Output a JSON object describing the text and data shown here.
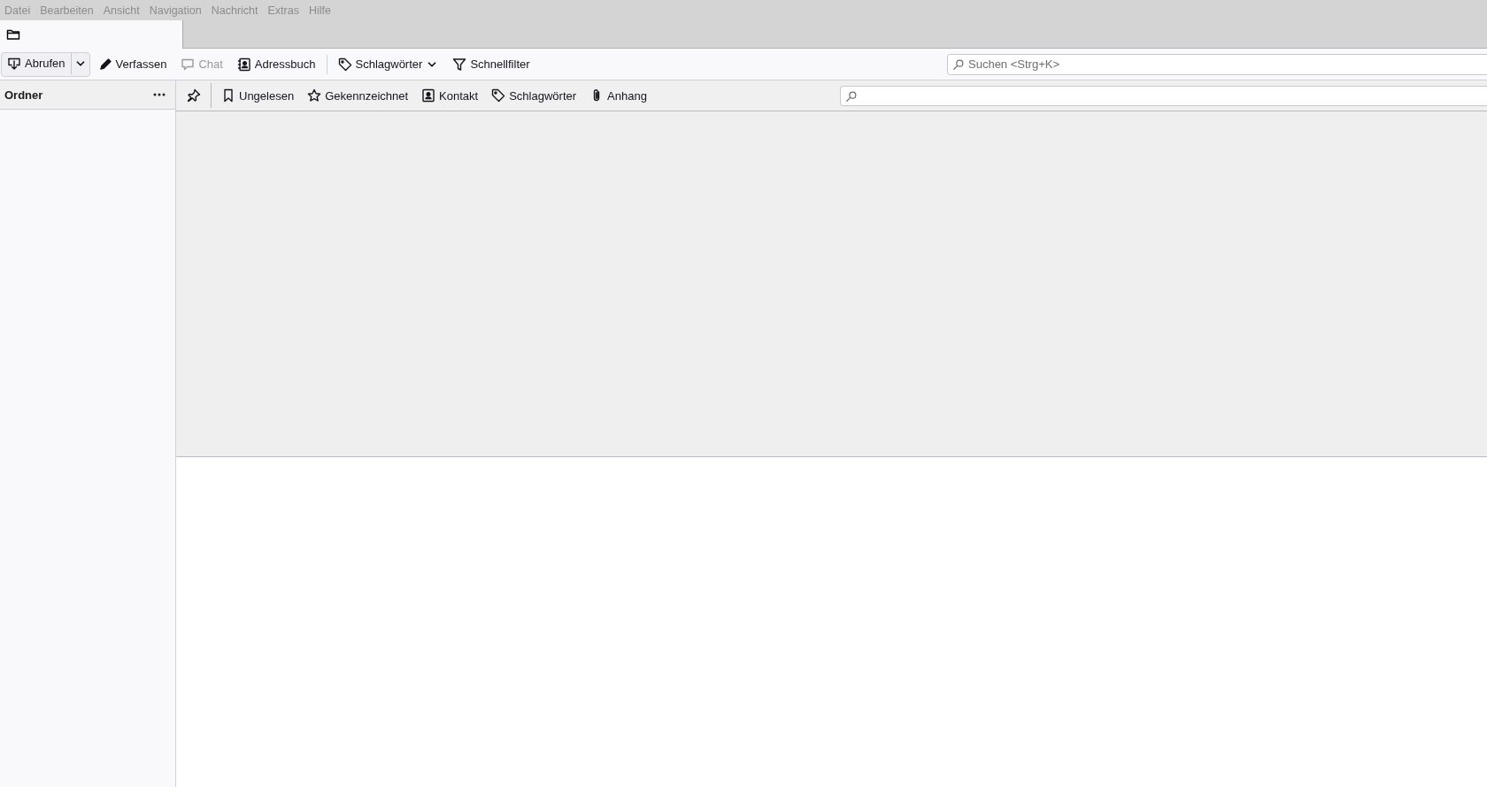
{
  "menu_bar": [
    {
      "label": "Datei",
      "disabled": true
    },
    {
      "label": "Bearbeiten",
      "disabled": true
    },
    {
      "label": "Ansicht",
      "disabled": true
    },
    {
      "label": "Navigation",
      "disabled": true
    },
    {
      "label": "Nachricht",
      "disabled": true
    },
    {
      "label": "Extras",
      "disabled": true
    },
    {
      "label": "Hilfe",
      "disabled": true
    }
  ],
  "tabs": [
    {
      "kind": "folder",
      "selected": true
    }
  ],
  "toolbar": {
    "buttons": [
      {
        "kind": "get",
        "label": "Abrufen",
        "disabled": false
      },
      {
        "kind": "write",
        "label": "Verfassen",
        "disabled": false
      },
      {
        "kind": "chat",
        "label": "Chat",
        "disabled": true
      },
      {
        "kind": "addressbook",
        "label": "Adressbuch",
        "disabled": false
      },
      {
        "kind": "separator"
      },
      {
        "kind": "tag",
        "label": "Schlagwörter",
        "disabled": false
      },
      {
        "kind": "filter",
        "label": "Schnellfilter",
        "disabled": false
      }
    ],
    "search": {
      "placeholder": "Suchen <Strg+K>"
    }
  },
  "folder_pane": {
    "title": "Ordner"
  },
  "quick_filter": {
    "buttons": [
      {
        "kind": "pin"
      },
      {
        "kind": "separator"
      },
      {
        "kind": "unread",
        "label": "Ungelesen",
        "selected": false
      },
      {
        "kind": "star",
        "label": "Gekennzeichnet",
        "selected": false
      },
      {
        "kind": "contact",
        "label": "Kontakt",
        "selected": false
      },
      {
        "kind": "tag",
        "label": "Schlagwörter",
        "selected": false
      },
      {
        "kind": "attachment",
        "label": "Anhang",
        "selected": false
      }
    ]
  }
}
